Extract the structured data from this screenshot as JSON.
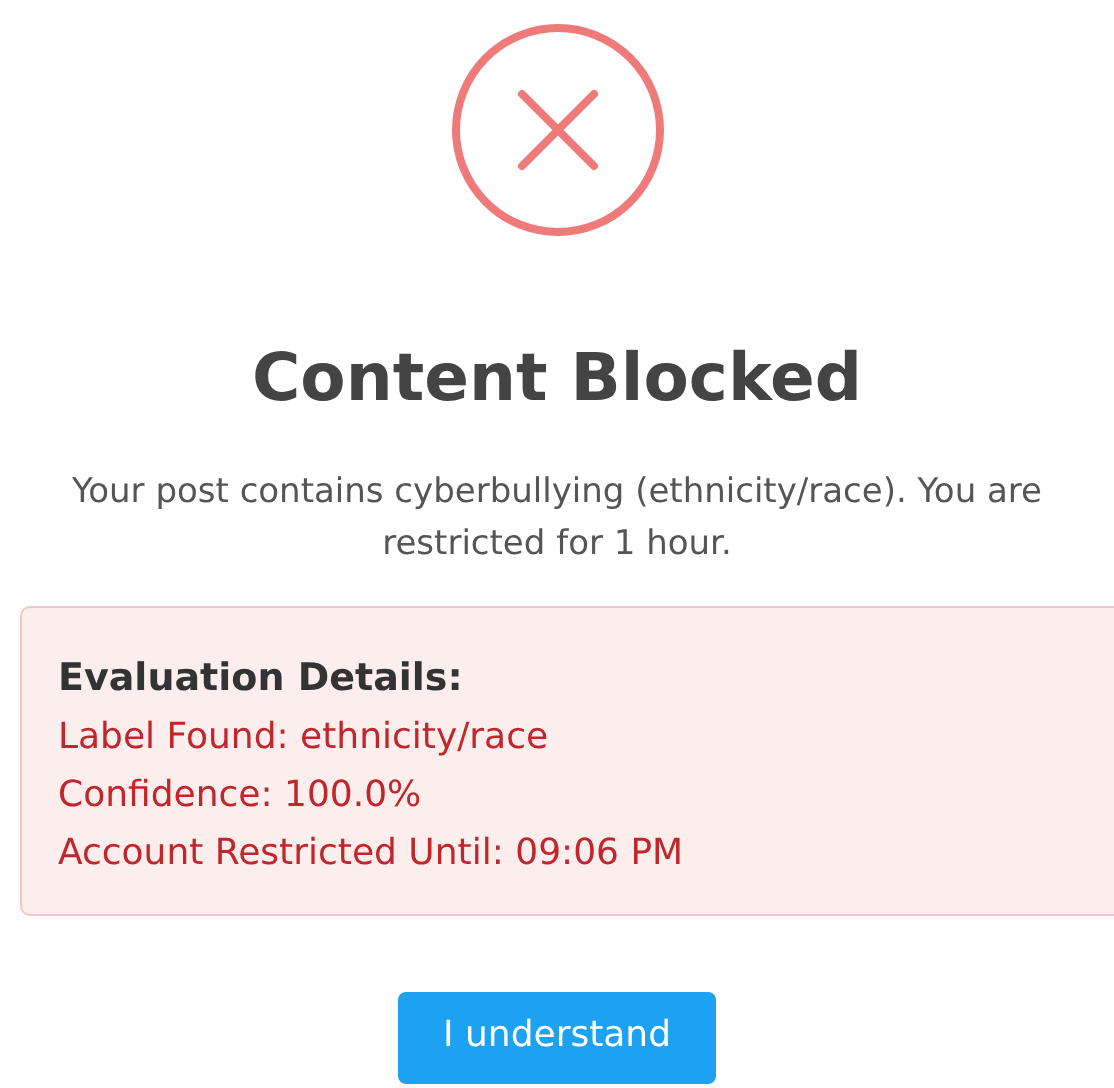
{
  "title": "Content Blocked",
  "message": "Your post contains cyberbullying (ethnicity/race). You are restricted for 1 hour.",
  "details": {
    "heading": "Evaluation Details:",
    "lines": [
      "Label Found: ethnicity/race",
      "Confidence: 100.0%",
      "Account Restricted Until: 09:06 PM"
    ]
  },
  "button": "I understand"
}
